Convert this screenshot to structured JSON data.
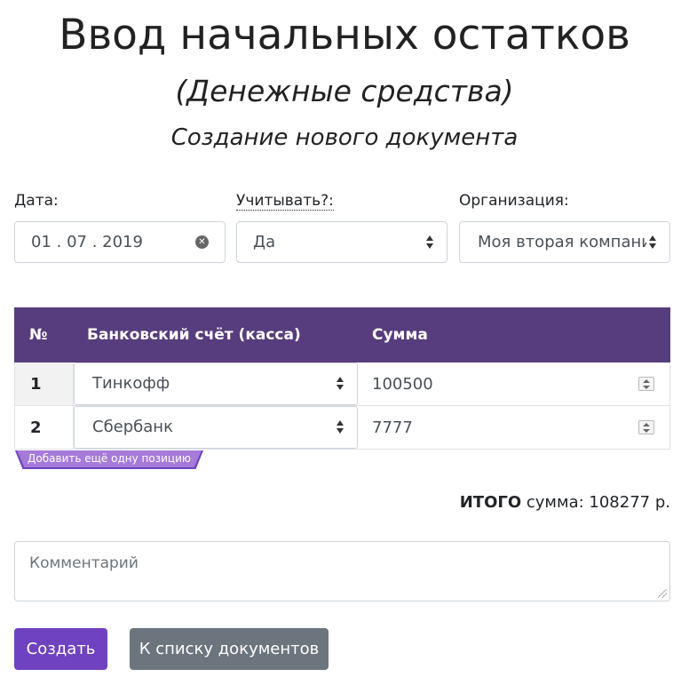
{
  "page": {
    "title": "Ввод начальных остатков",
    "subtitle": "(Денежные средства)",
    "doc_title": "Создание нового документа"
  },
  "form": {
    "date_label": "Дата:",
    "date_value": "01 . 07 . 2019",
    "account_label": "Учитывать?:",
    "account_value": "Да",
    "org_label": "Организация:",
    "org_value": "Моя вторая компания"
  },
  "table": {
    "headers": [
      "№",
      "Банковский счёт (касса)",
      "Сумма"
    ],
    "rows": [
      {
        "num": "1",
        "account": "Тинкофф",
        "sum": "100500"
      },
      {
        "num": "2",
        "account": "Сбербанк",
        "sum": "7777"
      }
    ],
    "add_label": "Добавить ещё одну позицию"
  },
  "total": {
    "bold": "ИТОГО",
    "label": " сумма: ",
    "value": "108277 р."
  },
  "comment": {
    "placeholder": "Комментарий"
  },
  "buttons": {
    "create": "Создать",
    "to_list": "К списку документов"
  },
  "colors": {
    "primary": "#6f42c1",
    "table_header": "#573d7d",
    "secondary": "#6c757d"
  }
}
